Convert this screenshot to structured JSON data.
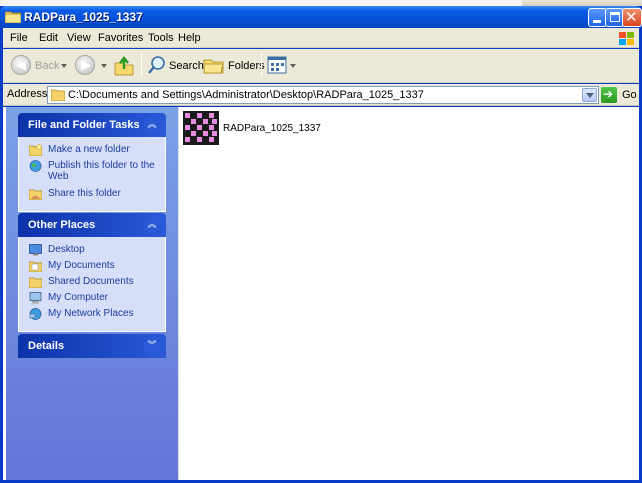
{
  "window": {
    "title": "RADPara_1025_1337"
  },
  "menu": [
    "File",
    "Edit",
    "View",
    "Favorites",
    "Tools",
    "Help"
  ],
  "toolbar": {
    "back_label": "Back",
    "search_label": "Search",
    "folders_label": "Folders"
  },
  "address": {
    "label": "Address",
    "value": "C:\\Documents and Settings\\Administrator\\Desktop\\RADPara_1025_1337",
    "go_label": "Go"
  },
  "sidebar": {
    "file_tasks": {
      "title": "File and Folder Tasks",
      "items": [
        {
          "label": "Make a new folder",
          "icon": "new-folder-icon"
        },
        {
          "label": "Publish this folder to the Web",
          "icon": "globe-icon"
        },
        {
          "label": "Share this folder",
          "icon": "share-folder-icon"
        }
      ]
    },
    "other_places": {
      "title": "Other Places",
      "items": [
        {
          "label": "Desktop",
          "icon": "desktop-icon"
        },
        {
          "label": "My Documents",
          "icon": "my-documents-icon"
        },
        {
          "label": "Shared Documents",
          "icon": "shared-folder-icon"
        },
        {
          "label": "My Computer",
          "icon": "computer-icon"
        },
        {
          "label": "My Network Places",
          "icon": "network-icon"
        }
      ]
    },
    "details": {
      "title": "Details"
    }
  },
  "files": [
    {
      "name": "RADPara_1025_1337"
    }
  ],
  "colors": {
    "title_bar": "#0a5ce8",
    "sidebar": "#7ba2e7",
    "panel_header": "#0c32a8",
    "panel_body": "#d6dff7",
    "link": "#1c3da0",
    "chrome": "#ece9d8"
  }
}
